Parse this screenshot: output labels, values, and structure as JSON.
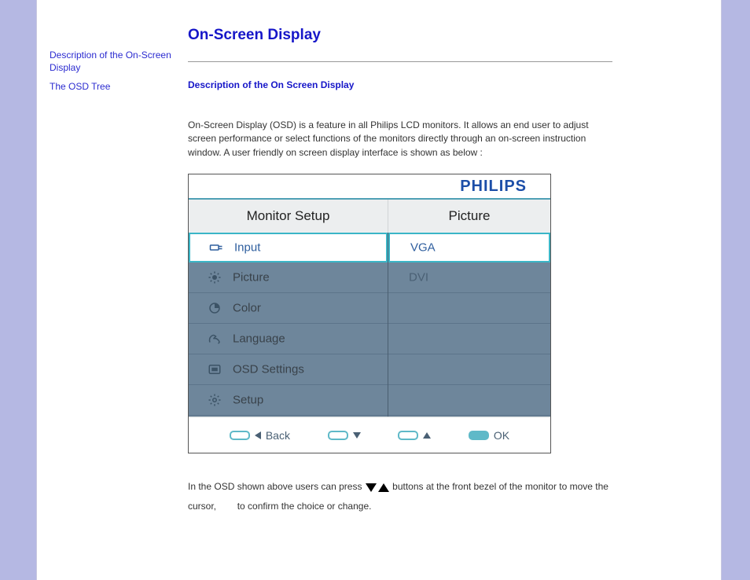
{
  "sidebar": {
    "link1": "Description of the On-Screen Display",
    "link2": "The OSD Tree"
  },
  "content": {
    "title": "On-Screen Display",
    "subhead": "Description of the On Screen Display",
    "p1": "On-Screen Display (OSD) is a feature in all Philips LCD monitors. It allows an end user to adjust screen performance or select functions of the monitors directly through an on-screen instruction window. A user friendly on screen display interface is shown as below :",
    "p2a": "In the OSD shown above users can press",
    "p2b": "buttons at the front bezel of the monitor to move the cursor,",
    "p2c": "to confirm the choice or change."
  },
  "osd": {
    "logo": "PHILIPS",
    "header_left": "Monitor Setup",
    "header_right": "Picture",
    "menu": {
      "0": "Input",
      "1": "Picture",
      "2": "Color",
      "3": "Language",
      "4": "OSD Settings",
      "5": "Setup"
    },
    "options": {
      "0": "VGA",
      "1": "DVI"
    },
    "footer": {
      "back": "Back",
      "ok": "OK"
    }
  }
}
